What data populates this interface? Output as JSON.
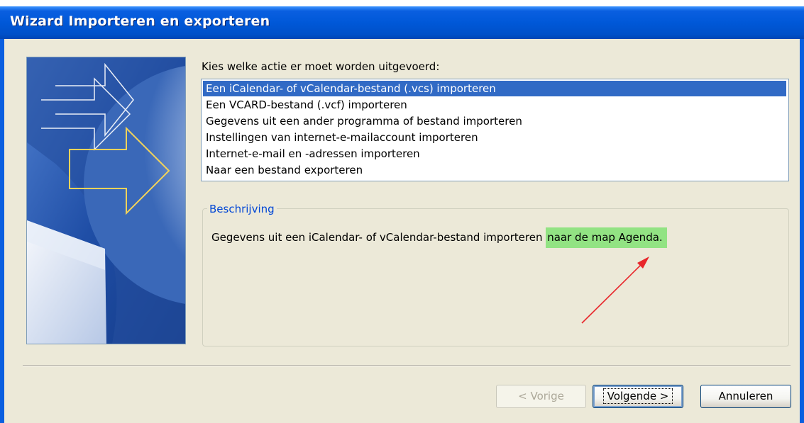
{
  "window": {
    "title": "Wizard Importeren en exporteren"
  },
  "action_list": {
    "prompt": "Kies welke actie er moet worden uitgevoerd:",
    "items": [
      "Een iCalendar- of vCalendar-bestand (.vcs) importeren",
      "Een VCARD-bestand (.vcf) importeren",
      "Gegevens uit een ander programma of bestand importeren",
      "Instellingen van internet-e-mailaccount importeren",
      "Internet-e-mail en -adressen importeren",
      "Naar een bestand exporteren"
    ],
    "selected_index": 0
  },
  "description": {
    "label": "Beschrijving",
    "text": "Gegevens uit een iCalendar- of vCalendar-bestand importeren ",
    "highlighted_text": "naar de map Agenda."
  },
  "buttons": {
    "back": "< Vorige",
    "next": "Volgende >",
    "cancel": "Annuleren"
  },
  "colors": {
    "titlebar": "#0058d8",
    "selection": "#316ac5",
    "highlight": "#92e383",
    "annotation_arrow": "#e8262a",
    "group_label": "#0046d5"
  }
}
